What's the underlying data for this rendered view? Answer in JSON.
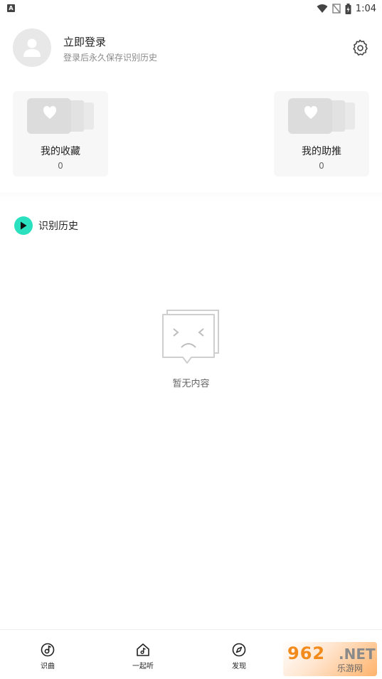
{
  "status_bar": {
    "app_icon": "A",
    "time": "1:04",
    "icons": [
      "wifi-icon",
      "no-signal-icon",
      "battery-charging-icon"
    ]
  },
  "profile": {
    "title": "立即登录",
    "subtitle": "登录后永久保存识别历史",
    "avatar_icon": "user-icon",
    "settings_icon": "gear-icon"
  },
  "cards": [
    {
      "label": "我的收藏",
      "count": "0",
      "icon": "heart-icon"
    },
    {
      "label": "我的助推",
      "count": "0",
      "icon": "heart-icon"
    }
  ],
  "history": {
    "title": "识别历史",
    "icon": "play-icon",
    "accent": "#2be0bf",
    "empty_text": "暂无内容",
    "empty_icon": "sad-face-icon"
  },
  "tabs": [
    {
      "label": "识曲",
      "icon": "music-note-icon"
    },
    {
      "label": "一起听",
      "icon": "home-music-icon"
    },
    {
      "label": "发现",
      "icon": "compass-icon"
    }
  ],
  "watermark": {
    "main": "962",
    "suffix": ".NET",
    "sub": "乐游网"
  }
}
